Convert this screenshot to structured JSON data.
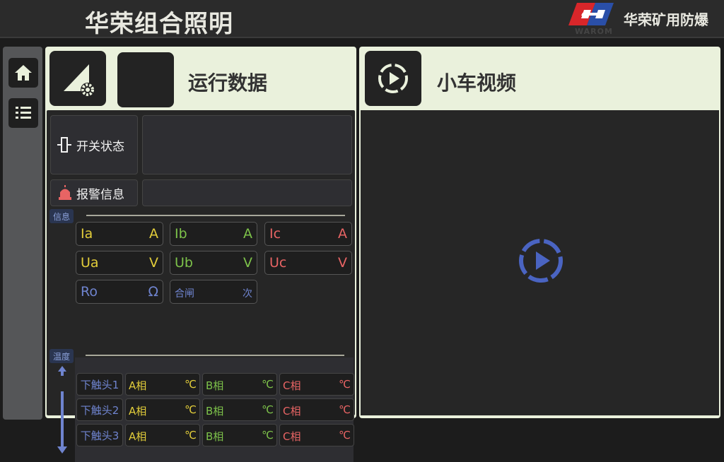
{
  "header": {
    "title": "华荣组合照明",
    "company": "华荣矿用防爆",
    "logo_text": "WAROM"
  },
  "sidebar": {
    "items": [
      {
        "icon": "home-icon"
      },
      {
        "icon": "list-icon"
      }
    ]
  },
  "left_panel": {
    "title": "运行数据",
    "switch_label": "开关状态",
    "alarm_label": "报警信息",
    "info_tag": "信息",
    "temp_tag": "温度",
    "meters": [
      {
        "name": "Ia",
        "unit": "A",
        "color": "#e2cd3a"
      },
      {
        "name": "Ib",
        "unit": "A",
        "color": "#7dc24a"
      },
      {
        "name": "Ic",
        "unit": "A",
        "color": "#e86464"
      },
      {
        "name": "Ua",
        "unit": "V",
        "color": "#e2cd3a"
      },
      {
        "name": "Ub",
        "unit": "V",
        "color": "#7dc24a"
      },
      {
        "name": "Uc",
        "unit": "V",
        "color": "#e86464"
      },
      {
        "name": "Ro",
        "unit": "Ω",
        "color": "#6f84cf"
      },
      {
        "name": "合闸",
        "unit": "次",
        "color": "#6f84cf"
      }
    ],
    "temp_rows": [
      {
        "label": "下触头1",
        "phases": [
          {
            "name": "A相",
            "unit": "℃"
          },
          {
            "name": "B相",
            "unit": "℃"
          },
          {
            "name": "C相",
            "unit": "℃"
          }
        ]
      },
      {
        "label": "下触头2",
        "phases": [
          {
            "name": "A相",
            "unit": "℃"
          },
          {
            "name": "B相",
            "unit": "℃"
          },
          {
            "name": "C相",
            "unit": "℃"
          }
        ]
      },
      {
        "label": "下触头3",
        "phases": [
          {
            "name": "A相",
            "unit": "℃"
          },
          {
            "name": "B相",
            "unit": "℃"
          },
          {
            "name": "C相",
            "unit": "℃"
          }
        ]
      }
    ]
  },
  "right_panel": {
    "title": "小车视频"
  }
}
